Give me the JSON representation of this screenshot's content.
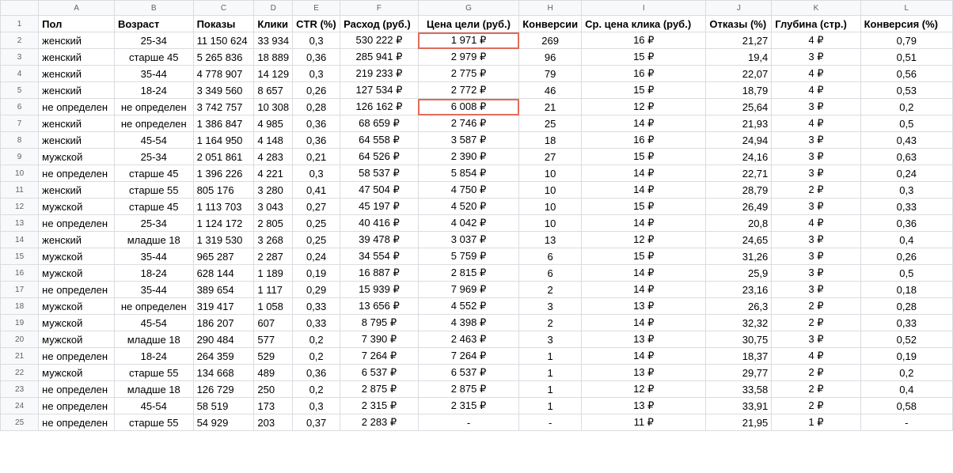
{
  "columns": [
    "A",
    "B",
    "C",
    "D",
    "E",
    "F",
    "G",
    "H",
    "I",
    "J",
    "K",
    "L"
  ],
  "highlight_color": "#e06c5a",
  "rows": [
    {
      "n": "1",
      "cells": [
        "Пол",
        "Возраст",
        "Показы",
        "Клики",
        "CTR (%)",
        "Расход (руб.)",
        "Цена цели (руб.)",
        "Конверсии",
        "Ср. цена клика (руб.)",
        "Отказы (%)",
        "Глубина (стр.)",
        "Конверсия (%)"
      ]
    },
    {
      "n": "2",
      "cells": [
        "женский",
        "25-34",
        "11 150 624",
        "33 934",
        "0,3",
        "530 222 ₽",
        "1 971 ₽",
        "269",
        "16 ₽",
        "21,27",
        "4 ₽",
        "0,79"
      ]
    },
    {
      "n": "3",
      "cells": [
        "женский",
        "старше 45",
        "5 265 836",
        "18 889",
        "0,36",
        "285 941 ₽",
        "2 979 ₽",
        "96",
        "15 ₽",
        "19,4",
        "3 ₽",
        "0,51"
      ]
    },
    {
      "n": "4",
      "cells": [
        "женский",
        "35-44",
        "4 778 907",
        "14 129",
        "0,3",
        "219 233 ₽",
        "2 775 ₽",
        "79",
        "16 ₽",
        "22,07",
        "4 ₽",
        "0,56"
      ]
    },
    {
      "n": "5",
      "cells": [
        "женский",
        "18-24",
        "3 349 560",
        "8 657",
        "0,26",
        "127 534 ₽",
        "2 772 ₽",
        "46",
        "15 ₽",
        "18,79",
        "4 ₽",
        "0,53"
      ]
    },
    {
      "n": "6",
      "cells": [
        "не определен",
        "не определен",
        "3 742 757",
        "10 308",
        "0,28",
        "126 162 ₽",
        "6 008 ₽",
        "21",
        "12 ₽",
        "25,64",
        "3 ₽",
        "0,2"
      ]
    },
    {
      "n": "7",
      "cells": [
        "женский",
        "не определен",
        "1 386 847",
        "4 985",
        "0,36",
        "68 659 ₽",
        "2 746 ₽",
        "25",
        "14 ₽",
        "21,93",
        "4 ₽",
        "0,5"
      ]
    },
    {
      "n": "8",
      "cells": [
        "женский",
        "45-54",
        "1 164 950",
        "4 148",
        "0,36",
        "64 558 ₽",
        "3 587 ₽",
        "18",
        "16 ₽",
        "24,94",
        "3 ₽",
        "0,43"
      ]
    },
    {
      "n": "9",
      "cells": [
        "мужской",
        "25-34",
        "2 051 861",
        "4 283",
        "0,21",
        "64 526 ₽",
        "2 390 ₽",
        "27",
        "15 ₽",
        "24,16",
        "3 ₽",
        "0,63"
      ]
    },
    {
      "n": "10",
      "cells": [
        "не определен",
        "старше 45",
        "1 396 226",
        "4 221",
        "0,3",
        "58 537 ₽",
        "5 854 ₽",
        "10",
        "14 ₽",
        "22,71",
        "3 ₽",
        "0,24"
      ]
    },
    {
      "n": "11",
      "cells": [
        "женский",
        "старше 55",
        "805 176",
        "3 280",
        "0,41",
        "47 504 ₽",
        "4 750 ₽",
        "10",
        "14 ₽",
        "28,79",
        "2 ₽",
        "0,3"
      ]
    },
    {
      "n": "12",
      "cells": [
        "мужской",
        "старше 45",
        "1 113 703",
        "3 043",
        "0,27",
        "45 197 ₽",
        "4 520 ₽",
        "10",
        "15 ₽",
        "26,49",
        "3 ₽",
        "0,33"
      ]
    },
    {
      "n": "13",
      "cells": [
        "не определен",
        "25-34",
        "1 124 172",
        "2 805",
        "0,25",
        "40 416 ₽",
        "4 042 ₽",
        "10",
        "14 ₽",
        "20,8",
        "4 ₽",
        "0,36"
      ]
    },
    {
      "n": "14",
      "cells": [
        "женский",
        "младше 18",
        "1 319 530",
        "3 268",
        "0,25",
        "39 478 ₽",
        "3 037 ₽",
        "13",
        "12 ₽",
        "24,65",
        "3 ₽",
        "0,4"
      ]
    },
    {
      "n": "15",
      "cells": [
        "мужской",
        "35-44",
        "965 287",
        "2 287",
        "0,24",
        "34 554 ₽",
        "5 759 ₽",
        "6",
        "15 ₽",
        "31,26",
        "3 ₽",
        "0,26"
      ]
    },
    {
      "n": "16",
      "cells": [
        "мужской",
        "18-24",
        "628 144",
        "1 189",
        "0,19",
        "16 887 ₽",
        "2 815 ₽",
        "6",
        "14 ₽",
        "25,9",
        "3 ₽",
        "0,5"
      ]
    },
    {
      "n": "17",
      "cells": [
        "не определен",
        "35-44",
        "389 654",
        "1 117",
        "0,29",
        "15 939 ₽",
        "7 969 ₽",
        "2",
        "14 ₽",
        "23,16",
        "3 ₽",
        "0,18"
      ]
    },
    {
      "n": "18",
      "cells": [
        "мужской",
        "не определен",
        "319 417",
        "1 058",
        "0,33",
        "13 656 ₽",
        "4 552 ₽",
        "3",
        "13 ₽",
        "26,3",
        "2 ₽",
        "0,28"
      ]
    },
    {
      "n": "19",
      "cells": [
        "мужской",
        "45-54",
        "186 207",
        "607",
        "0,33",
        "8 795 ₽",
        "4 398 ₽",
        "2",
        "14 ₽",
        "32,32",
        "2 ₽",
        "0,33"
      ]
    },
    {
      "n": "20",
      "cells": [
        "мужской",
        "младше 18",
        "290 484",
        "577",
        "0,2",
        "7 390 ₽",
        "2 463 ₽",
        "3",
        "13 ₽",
        "30,75",
        "3 ₽",
        "0,52"
      ]
    },
    {
      "n": "21",
      "cells": [
        "не определен",
        "18-24",
        "264 359",
        "529",
        "0,2",
        "7 264 ₽",
        "7 264 ₽",
        "1",
        "14 ₽",
        "18,37",
        "4 ₽",
        "0,19"
      ]
    },
    {
      "n": "22",
      "cells": [
        "мужской",
        "старше 55",
        "134 668",
        "489",
        "0,36",
        "6 537 ₽",
        "6 537 ₽",
        "1",
        "13 ₽",
        "29,77",
        "2 ₽",
        "0,2"
      ]
    },
    {
      "n": "23",
      "cells": [
        "не определен",
        "младше 18",
        "126 729",
        "250",
        "0,2",
        "2 875 ₽",
        "2 875 ₽",
        "1",
        "12 ₽",
        "33,58",
        "2 ₽",
        "0,4"
      ]
    },
    {
      "n": "24",
      "cells": [
        "не определен",
        "45-54",
        "58 519",
        "173",
        "0,3",
        "2 315 ₽",
        "2 315 ₽",
        "1",
        "13 ₽",
        "33,91",
        "2 ₽",
        "0,58"
      ]
    },
    {
      "n": "25",
      "cells": [
        "не определен",
        "старше 55",
        "54 929",
        "203",
        "0,37",
        "2 283 ₽",
        "-",
        "-",
        "11 ₽",
        "21,95",
        "1 ₽",
        "-"
      ]
    }
  ]
}
